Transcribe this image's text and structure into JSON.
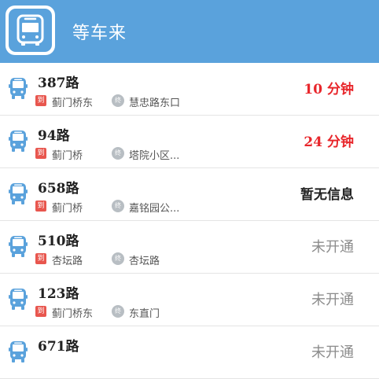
{
  "app": {
    "title": "等车来",
    "icon": "bus-icon",
    "header_color": "#5aa2dc"
  },
  "labels": {
    "arrive_badge": "到",
    "terminal_badge": "终"
  },
  "routes": [
    {
      "name": "387路",
      "from": "蓟门桥东",
      "to": "慧忠路东口",
      "eta": "10 分钟"
    },
    {
      "name": "94路",
      "from": "蓟门桥",
      "to": "塔院小区...",
      "eta": "24 分钟"
    },
    {
      "name": "658路",
      "from": "蓟门桥",
      "to": "嘉铭园公...",
      "eta": "暂无信息"
    },
    {
      "name": "510路",
      "from": "杏坛路",
      "to": "杏坛路",
      "eta": "未开通"
    },
    {
      "name": "123路",
      "from": "蓟门桥东",
      "to": "东直门",
      "eta": "未开通"
    },
    {
      "name": "671路",
      "from": "",
      "to": "",
      "eta": "未开通"
    }
  ],
  "colors": {
    "eta_red": "#e8262b",
    "eta_grey": "#8c8c8c",
    "bus_blue": "#5aa2dc"
  }
}
